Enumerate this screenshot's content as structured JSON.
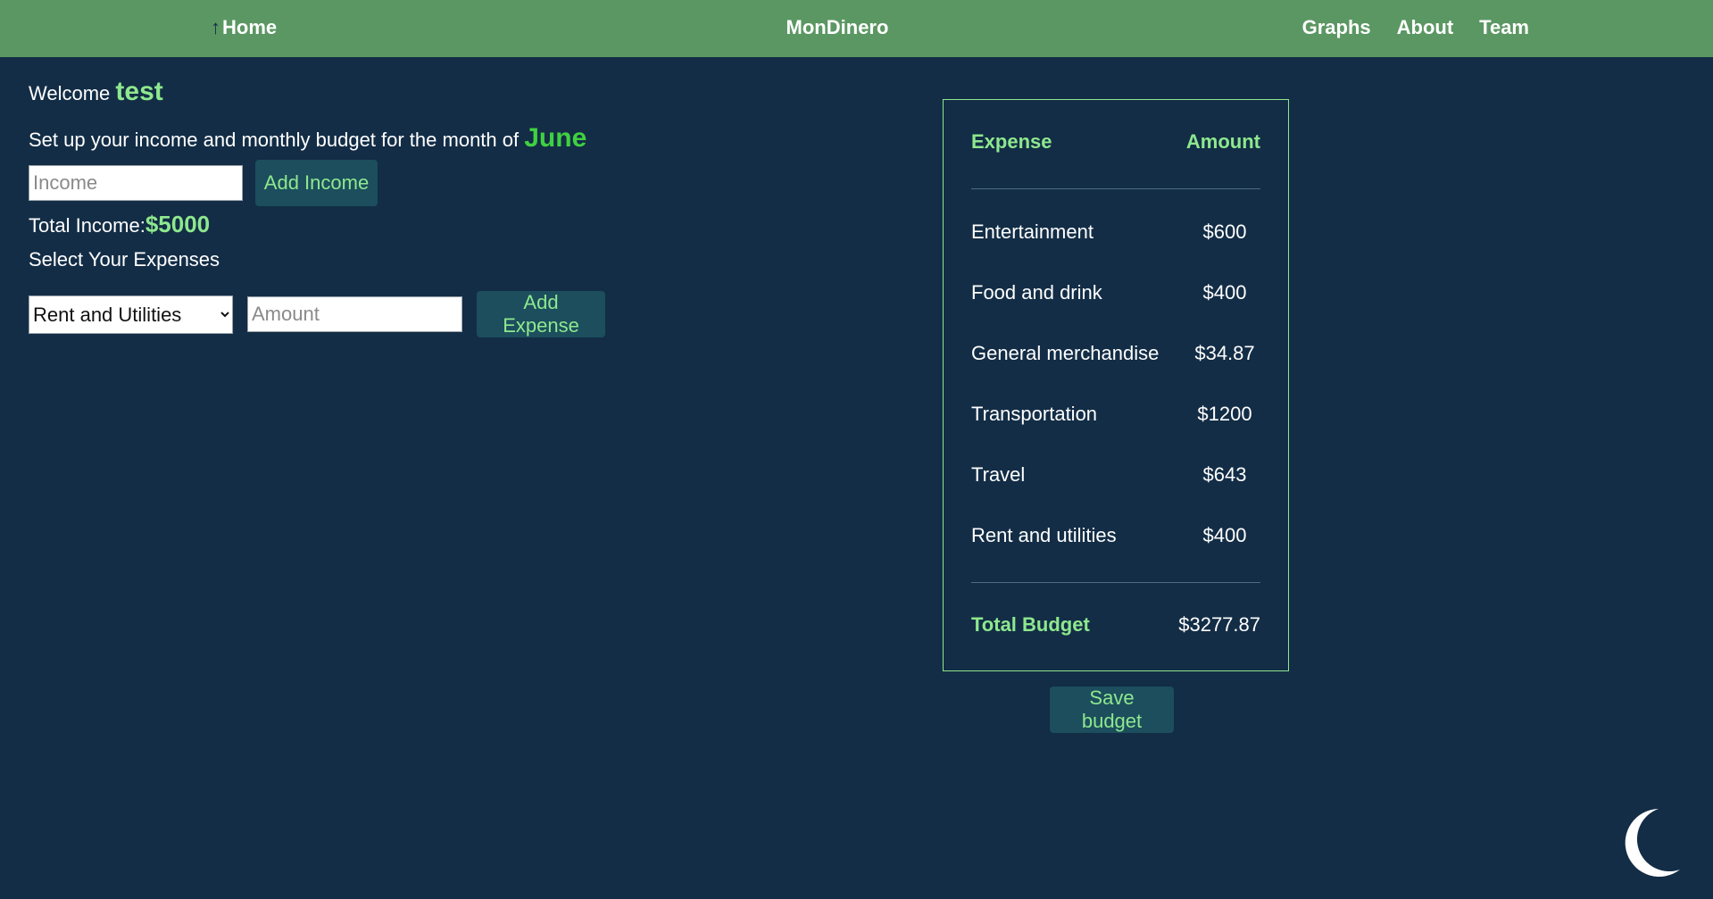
{
  "nav": {
    "home_label": "Home",
    "home_icon": "arrow-up-icon",
    "brand": "MonDinero",
    "links": [
      "Graphs",
      "About",
      "Team"
    ]
  },
  "welcome": {
    "prefix": "Welcome",
    "username": "test"
  },
  "setup": {
    "text": "Set up your income and monthly budget for the month of",
    "month": "June"
  },
  "income": {
    "placeholder": "Income",
    "button": "Add Income",
    "total_label": "Total Income:",
    "total_value": "$5000"
  },
  "expenses": {
    "heading": "Select Your Expenses",
    "selected_category": "Rent and Utilities",
    "amount_placeholder": "Amount",
    "button": "Add Expense"
  },
  "budget_table": {
    "col_expense": "Expense",
    "col_amount": "Amount",
    "rows": [
      {
        "name": "Entertainment",
        "amount": "$600"
      },
      {
        "name": "Food and drink",
        "amount": "$400"
      },
      {
        "name": "General merchandise",
        "amount": "$34.87"
      },
      {
        "name": "Transportation",
        "amount": "$1200"
      },
      {
        "name": "Travel",
        "amount": "$643"
      },
      {
        "name": "Rent and utilities",
        "amount": "$400"
      }
    ],
    "total_label": "Total Budget",
    "total_value": "$3277.87"
  },
  "save_button": "Save budget",
  "theme_toggle_icon": "moon-icon",
  "colors": {
    "background": "#132d46",
    "navbar": "#5b9763",
    "accent_green": "#8ee88e",
    "month_green": "#40d140",
    "button_bg": "#1c4e5d"
  }
}
